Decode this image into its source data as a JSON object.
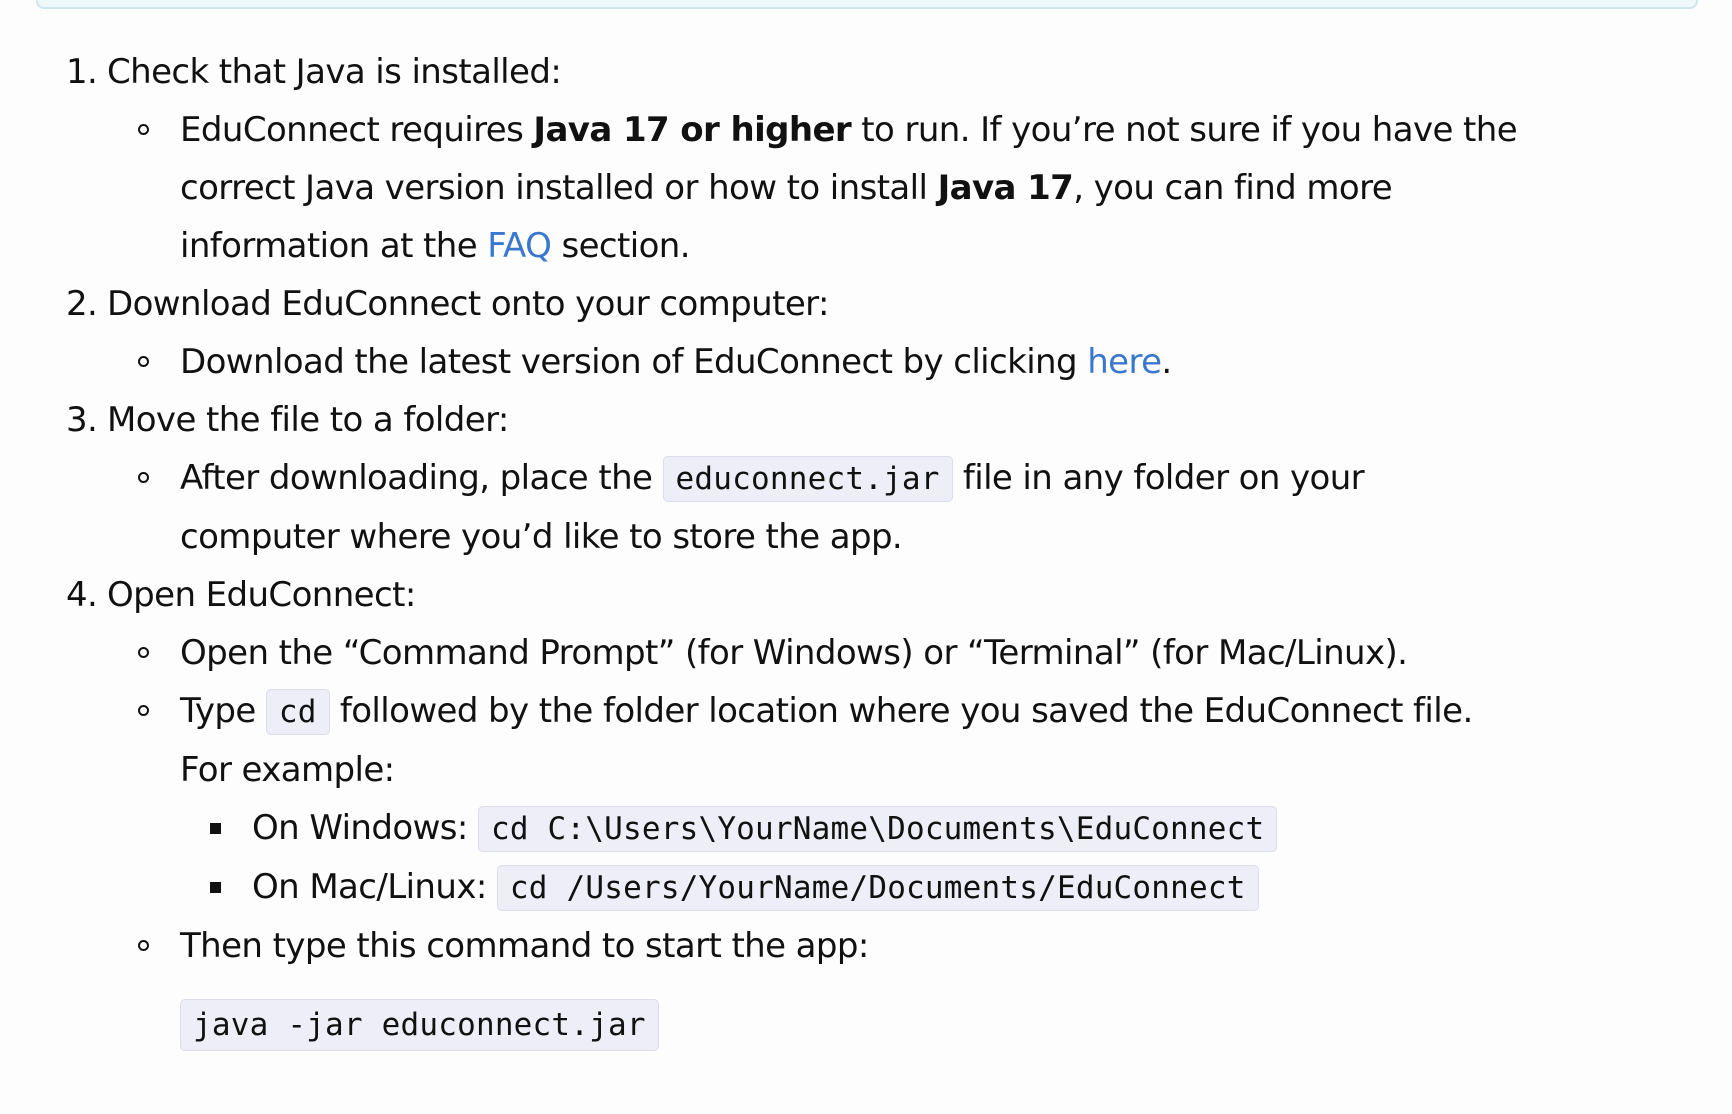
{
  "steps": [
    {
      "number": "1.",
      "title": "Check that Java is installed:",
      "items": [
        {
          "t1": "EduConnect requires ",
          "b1": "Java 17 or higher",
          "t2": " to run. If you’re not sure if you have the correct Java version installed or how to install ",
          "b2": "Java 17",
          "t3": ", you can find more information at the ",
          "link": "FAQ",
          "t4": " section."
        }
      ]
    },
    {
      "number": "2.",
      "title": "Download EduConnect onto your computer:",
      "items": [
        {
          "t1": "Download the latest version of EduConnect by clicking ",
          "link": "here",
          "t2": "."
        }
      ]
    },
    {
      "number": "3.",
      "title": "Move the file to a folder:",
      "items": [
        {
          "t1": "After downloading, place the ",
          "code": "educonnect.jar",
          "t2": " file in any folder on your computer where you’d like to store the app."
        }
      ]
    },
    {
      "number": "4.",
      "title": "Open EduConnect:",
      "items": [
        {
          "text": "Open the “Command Prompt” (for Windows) or “Terminal” (for Mac/Linux)."
        },
        {
          "t1": "Type ",
          "code": "cd",
          "t2": " followed by the folder location where you saved the EduConnect file. For example:",
          "examples": [
            {
              "label": "On Windows: ",
              "code": "cd C:\\Users\\YourName\\Documents\\EduConnect"
            },
            {
              "label": "On Mac/Linux: ",
              "code": "cd /Users/YourName/Documents/EduConnect"
            }
          ]
        },
        {
          "text": "Then type this command to start the app:",
          "code_block": "java -jar educonnect.jar"
        }
      ]
    }
  ]
}
